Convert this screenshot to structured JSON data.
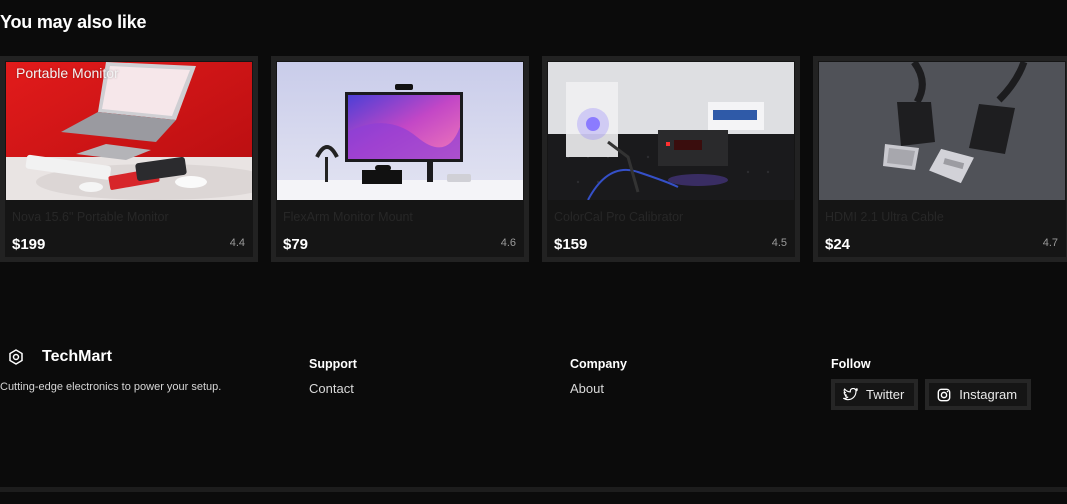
{
  "section": {
    "title": "You may also like"
  },
  "products": [
    {
      "name": "Nova 15.6\" Portable Monitor",
      "price": "$199",
      "rating": "4.4",
      "image_overlay": "Portable Monitor",
      "image": "laptop-on-red-desk"
    },
    {
      "name": "FlexArm Monitor Mount",
      "price": "$79",
      "rating": "4.6",
      "image_overlay": "",
      "image": "monitor-on-desk"
    },
    {
      "name": "ColorCal Pro Calibrator",
      "price": "$159",
      "rating": "4.5",
      "image_overlay": "",
      "image": "laser-calibrator"
    },
    {
      "name": "HDMI 2.1 Ultra Cable",
      "price": "$24",
      "rating": "4.7",
      "image_overlay": "",
      "image": "usb-cables"
    }
  ],
  "footer": {
    "brand": {
      "name": "TechMart",
      "tagline": "Cutting-edge electronics to power your setup.",
      "icon": "hexagon-icon"
    },
    "support": {
      "heading": "Support",
      "links": [
        "Contact"
      ]
    },
    "company": {
      "heading": "Company",
      "links": [
        "About"
      ]
    },
    "follow": {
      "heading": "Follow",
      "links": [
        {
          "label": "Twitter",
          "icon": "twitter-icon"
        },
        {
          "label": "Instagram",
          "icon": "instagram-icon"
        }
      ]
    }
  },
  "colors": {
    "background": "#0b0b0b",
    "card": "#151515",
    "card_border": "#222222",
    "text": "#ffffff"
  }
}
